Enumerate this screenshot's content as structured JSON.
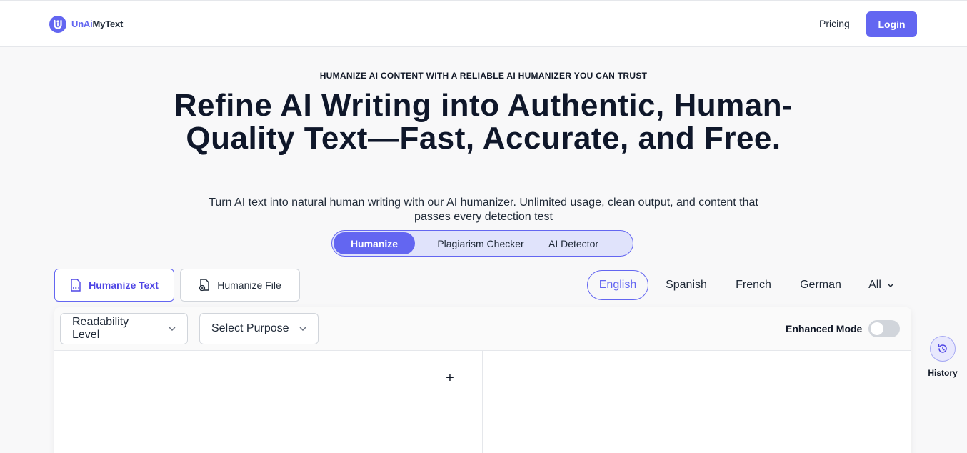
{
  "brand": {
    "name_part1": "UnAi",
    "name_part2": "MyText",
    "color": "#6366f1"
  },
  "nav": {
    "pricing": "Pricing",
    "login": "Login"
  },
  "hero": {
    "eyebrow": "HUMANIZE AI CONTENT WITH A RELIABLE AI HUMANIZER YOU CAN TRUST",
    "title": "Refine AI Writing into Authentic, Human-Quality Text—Fast, Accurate, and Free.",
    "subtitle": "Turn AI text into natural human writing with our AI humanizer. Unlimited usage, clean output, and content that passes every detection test"
  },
  "mode_tabs": [
    {
      "label": "Humanize",
      "active": true
    },
    {
      "label": "Plagiarism Checker",
      "active": false
    },
    {
      "label": "AI Detector",
      "active": false
    }
  ],
  "input_types": {
    "text": {
      "label": "Humanize Text",
      "icon": "txt-file-icon",
      "active": true
    },
    "file": {
      "label": "Humanize File",
      "icon": "file-upload-icon",
      "active": false
    }
  },
  "languages": [
    {
      "label": "English",
      "active": true
    },
    {
      "label": "Spanish",
      "active": false
    },
    {
      "label": "French",
      "active": false
    },
    {
      "label": "German",
      "active": false
    },
    {
      "label": "All",
      "active": false
    }
  ],
  "toolbar": {
    "readability": "Readability Level",
    "purpose": "Select Purpose",
    "enhanced_mode": "Enhanced Mode",
    "enhanced_mode_on": false
  },
  "editor": {
    "add_symbol": "+"
  },
  "history": {
    "label": "History",
    "icon": "history-icon"
  },
  "colors": {
    "accent": "#6366f1",
    "accent_light": "#e0e3fb",
    "background": "#f8f8f9"
  }
}
